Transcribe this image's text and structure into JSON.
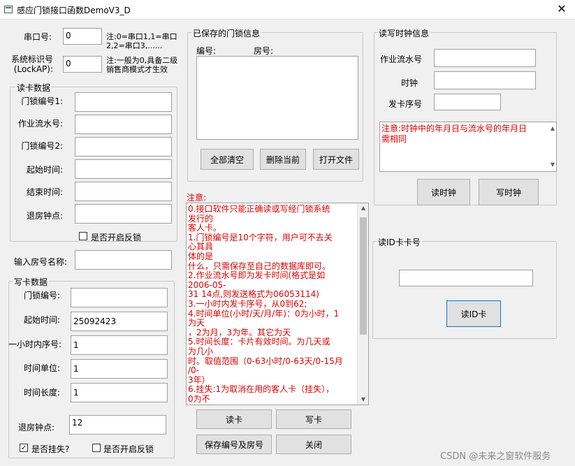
{
  "window": {
    "title": "感应门锁接口函数DemoV3_D",
    "close": "✕"
  },
  "top_fields": {
    "port_label": "串口号:",
    "port_value": "0",
    "port_note": "注:0=串口1,1=串口2,2=串口3,......",
    "sysid_label_1": "系统标识号",
    "sysid_label_2": "(LockAP):",
    "sysid_value": "0",
    "sysid_note": "注:一般为0,具备二级销售商模式才生效"
  },
  "read_card": {
    "group_label": "读卡数据",
    "fields": [
      {
        "label": "门锁编号1:",
        "value": ""
      },
      {
        "label": "作业流水号:",
        "value": ""
      },
      {
        "label": "门锁编号2:",
        "value": ""
      },
      {
        "label": "起始时间:",
        "value": ""
      },
      {
        "label": "结束时间:",
        "value": ""
      },
      {
        "label": "退房钟点:",
        "value": ""
      }
    ],
    "reverse_lock_label": "是否开启反锁"
  },
  "room_name": {
    "label": "输入房号名称:",
    "value": ""
  },
  "write_card": {
    "group_label": "写卡数据",
    "fields": [
      {
        "label": "门锁编号:",
        "value": ""
      },
      {
        "label": "起始时间:",
        "value": "25092423"
      },
      {
        "label": "一小时内序号:",
        "value": "1"
      },
      {
        "label": "时间单位:",
        "value": "1"
      },
      {
        "label": "时间长度:",
        "value": "1"
      },
      {
        "label": "退房钟点:",
        "value": "12"
      }
    ],
    "lost_label": "是否挂失?",
    "lost_checked": "✓",
    "reverse_lock_label": "是否开启反锁"
  },
  "saved_locks": {
    "group_label": "已保存的门锁信息",
    "col_id": "编号:",
    "col_room": "房号:",
    "buttons": {
      "clear_all": "全部清空",
      "delete_current": "删除当前",
      "open_file": "打开文件"
    }
  },
  "notes": {
    "label": "注意:",
    "lines": [
      "0.接口软件只能正确读或写经门锁系统",
      "发行的",
      "客人卡。",
      "1.门锁编号是10个字符，用户可不去关",
      "心其具",
      "体的是",
      "什么，只需保存至自己的数据库即可。",
      "2.作业流水号即为发卡时间(格式是如",
      "2006-05-",
      "31 14点,则发送格式为06053114)",
      "3.一小时内发卡序号，从0到62;",
      "4.时间单位(小时/天/月/年)：0为小时，1",
      "为天",
      "，2为月，3为年。其它为天",
      "5.时间长度：卡片有效时间。为几天或",
      "为几小",
      "时。取值范围（0-63小时/0-63天/0-15月",
      "/0-",
      "3年）",
      "6.挂失:1为取消在用的客人卡（挂失），",
      "0为不"
    ]
  },
  "actions": {
    "read": "读卡",
    "write": "写卡",
    "save": "保存编号及房号",
    "close": "关闭"
  },
  "clock": {
    "group_label": "读写时钟信息",
    "serial_label": "作业流水号",
    "serial_value": "",
    "clock_label": "时钟",
    "clock_value": "",
    "seq_label": "发卡序号",
    "seq_value": "",
    "note_lines": [
      "注意:时钟中的年月日与流水号的年月日",
      "需相同"
    ],
    "read_btn": "读时钟",
    "write_btn": "写时钟"
  },
  "id_card": {
    "group_label": "读ID卡卡号",
    "value": "",
    "read_btn": "读ID卡"
  },
  "watermark": "CSDN @未来之窗软件服务"
}
